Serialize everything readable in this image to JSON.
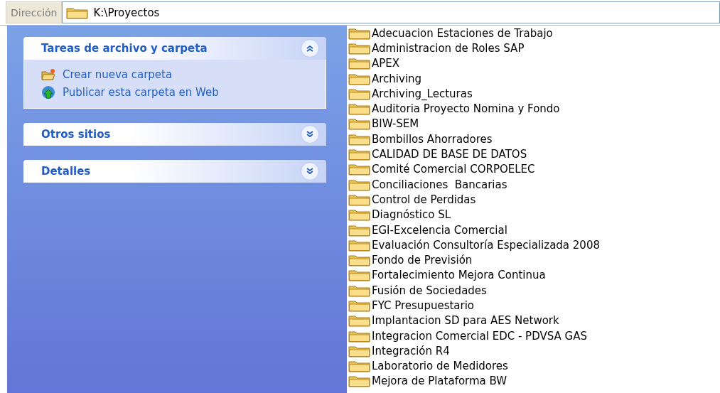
{
  "address_bar": {
    "label": "Dirección",
    "path": "K:\\Proyectos"
  },
  "task_panels": [
    {
      "title": "Tareas de archivo y carpeta",
      "expanded": true,
      "items": [
        {
          "kind": "new-folder",
          "label": "Crear nueva carpeta"
        },
        {
          "kind": "publish-web",
          "label": "Publicar esta carpeta en Web"
        }
      ]
    },
    {
      "title": "Otros sitios",
      "expanded": false
    },
    {
      "title": "Detalles",
      "expanded": false
    }
  ],
  "folders": [
    "Adecuacion Estaciones de Trabajo",
    "Administracion de Roles SAP",
    "APEX",
    "Archiving",
    "Archiving_Lecturas",
    "Auditoria Proyecto Nomina y Fondo",
    "BIW-SEM",
    "Bombillos Ahorradores",
    "CALIDAD DE BASE DE DATOS",
    "Comité Comercial CORPOELEC",
    "Conciliaciones  Bancarias",
    "Control de Perdidas",
    "Diagnóstico SL",
    "EGI-Excelencia Comercial",
    "Evaluación Consultoría Especializada 2008",
    "Fondo de Previsión",
    "Fortalecimiento Mejora Continua",
    "Fusión de Sociedades",
    "FYC Presupuestario",
    "Implantacion SD para AES Network",
    "Integracion Comercial EDC - PDVSA GAS",
    "Integración R4",
    "Laboratorio de Medidores",
    "Mejora de Plataforma BW"
  ]
}
